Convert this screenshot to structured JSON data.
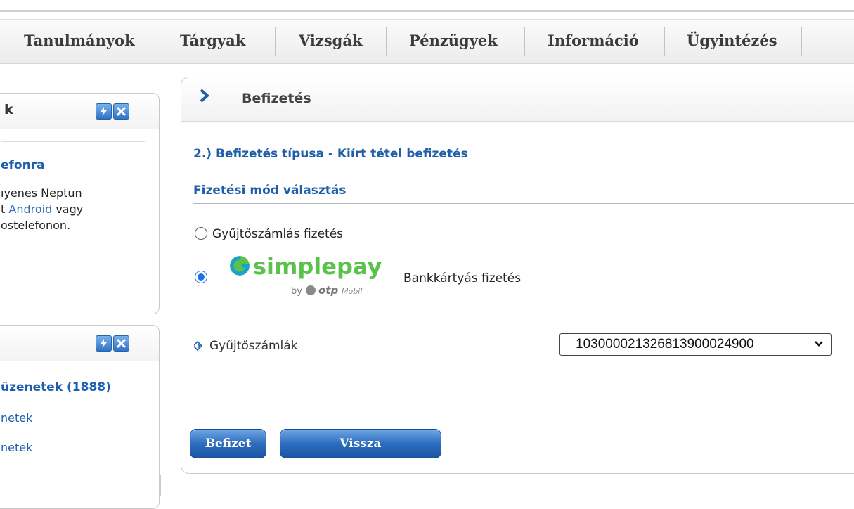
{
  "nav": {
    "items": [
      "Tanulmányok",
      "Tárgyak",
      "Vizsgák",
      "Pénzügyek",
      "Információ",
      "Ügyintézés"
    ]
  },
  "left_panel_1": {
    "title": "k",
    "link": "efonra",
    "lines": [
      "ıyenes Neptun",
      "t",
      "Android",
      " vagy",
      "ostelefonon."
    ]
  },
  "left_panel_2": {
    "link": "üzenetek (1888)",
    "items": [
      "netek",
      "netek"
    ]
  },
  "main": {
    "title": "Befizetés",
    "section1": "2.) Befizetés típusa - Kiírt tétel befizetés",
    "section2": "Fizetési mód választás",
    "options": [
      {
        "label": "Gyűjtőszámlás fizetés",
        "selected": false
      },
      {
        "label": "Bankkártyás fizetés",
        "selected": true
      }
    ],
    "simplepay": {
      "brand": "simplepay",
      "by": "by",
      "otp": "otp",
      "mobil": "Mobil"
    },
    "field_label": "Gyűjtőszámlák",
    "select_value": "103000021326813900024900",
    "buttons": {
      "pay": "Befizet",
      "back": "Vissza"
    }
  },
  "colors": {
    "accent": "#1f5ea8",
    "button": "#2d6dbe",
    "simplepay_green": "#5ac14a",
    "simplepay_blue": "#1aa0d8"
  },
  "icons": [
    "refresh-icon",
    "close-icon",
    "chevron-right-icon",
    "diamond-arrows-icon",
    "chevron-down-icon"
  ]
}
